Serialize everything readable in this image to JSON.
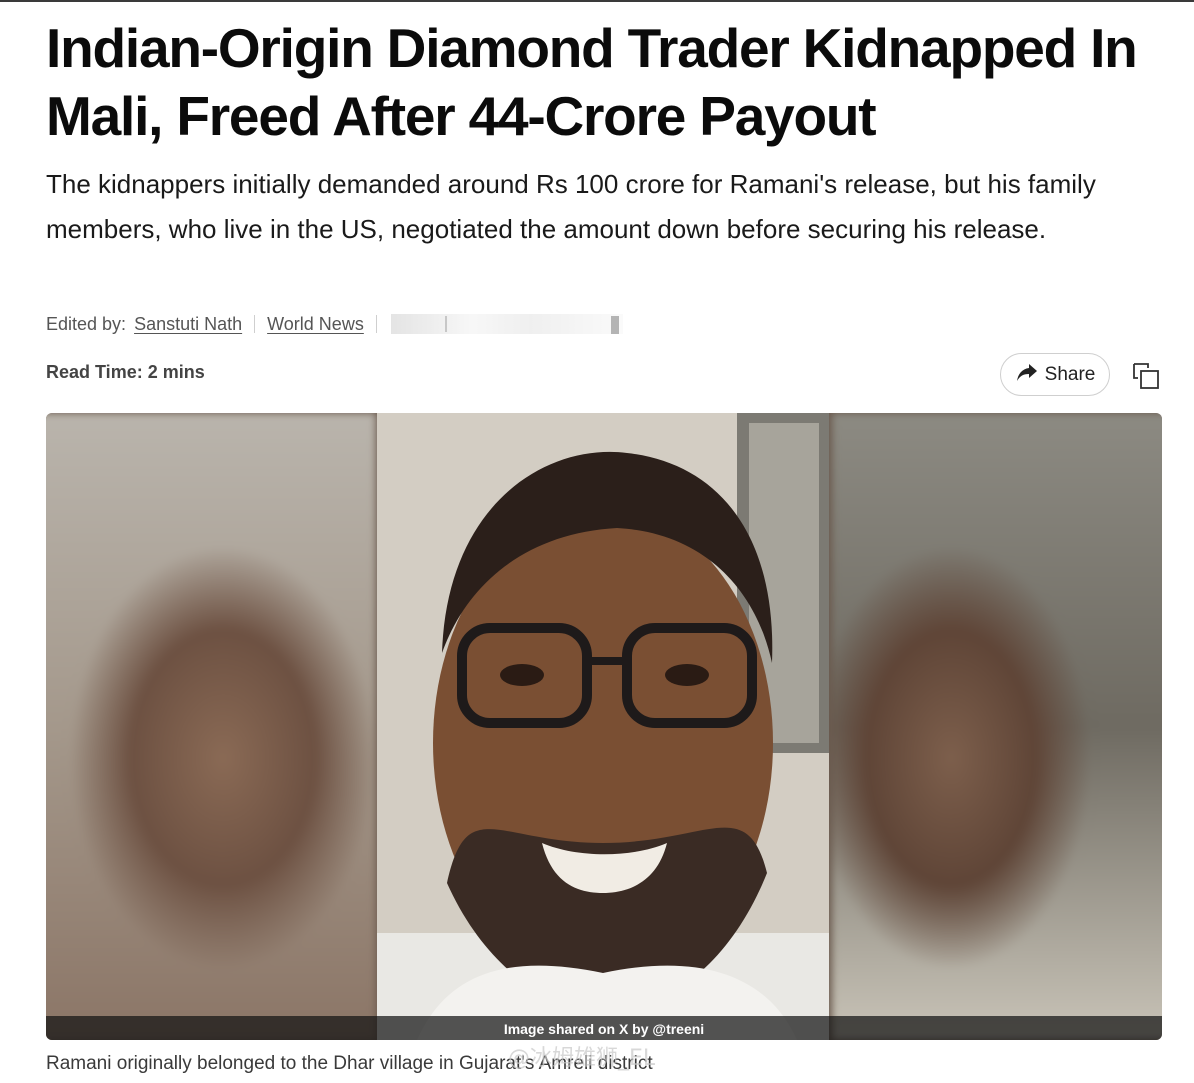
{
  "article": {
    "headline": "Indian-Origin Diamond Trader Kidnapped In Mali, Freed After 44-Crore Payout",
    "summary": "The kidnappers initially demanded around Rs 100 crore for Ramani's release, but his family members, who live in the US, negotiated the amount down before securing his release.",
    "edited_by_label": "Edited by:",
    "editor": "Sanstuti Nath",
    "category": "World News",
    "read_time_label": "Read Time:",
    "read_time_value": "2 mins"
  },
  "actions": {
    "share_label": "Share",
    "share_icon": "share-arrow-icon",
    "copy_icon": "copy-icon"
  },
  "image": {
    "credit": "Image shared on X by @treeni",
    "caption": "Ramani originally belonged to the Dhar village in Gujarat's Amreli district"
  },
  "watermark": {
    "text": "@冰姆雄狮_EL"
  },
  "colors": {
    "headline": "#0b0b0b",
    "meta_text": "#555555",
    "border": "#cfcfcf"
  }
}
